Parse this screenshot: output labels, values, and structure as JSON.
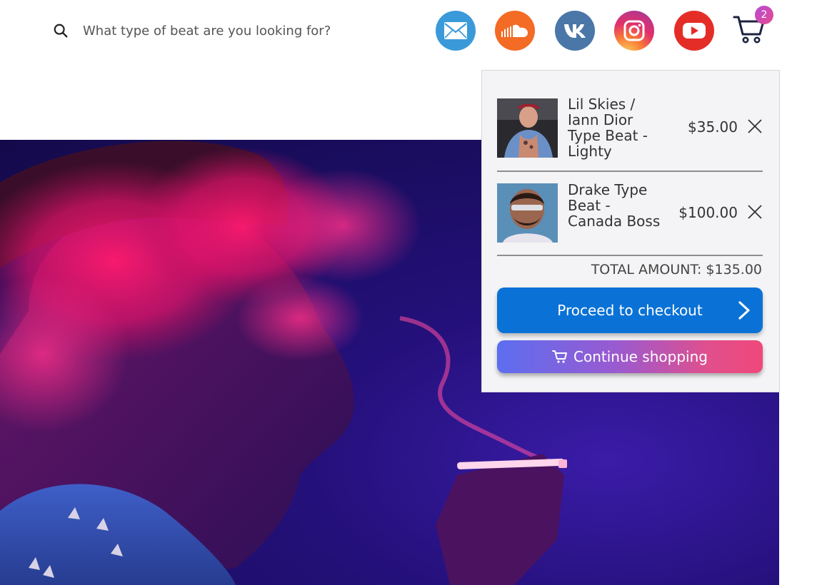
{
  "search": {
    "placeholder": "What type of beat are you looking for?"
  },
  "social": [
    {
      "icon": "mail-icon",
      "color": "#3a9ad9"
    },
    {
      "icon": "soundcloud-icon",
      "color": "#f36b24"
    },
    {
      "icon": "vk-icon",
      "color": "#4a76a8"
    },
    {
      "icon": "instagram-icon",
      "color": "#c13584"
    },
    {
      "icon": "youtube-icon",
      "color": "#e52d27"
    }
  ],
  "cart": {
    "count": "2",
    "items": [
      {
        "name": "Lil Skies / Iann Dior Type Beat - Lighty",
        "price": "$35.00"
      },
      {
        "name": "Drake Type Beat - Canada Boss",
        "price": "$100.00"
      }
    ],
    "total": "TOTAL AMOUNT: $135.00",
    "checkout_label": "Proceed to checkout",
    "continue_label": "Continue shopping"
  },
  "colors": {
    "checkout": "#0a72d6",
    "continue_start": "#5c6ef0",
    "continue_end": "#f0487a",
    "badge": "#c84bb5"
  }
}
